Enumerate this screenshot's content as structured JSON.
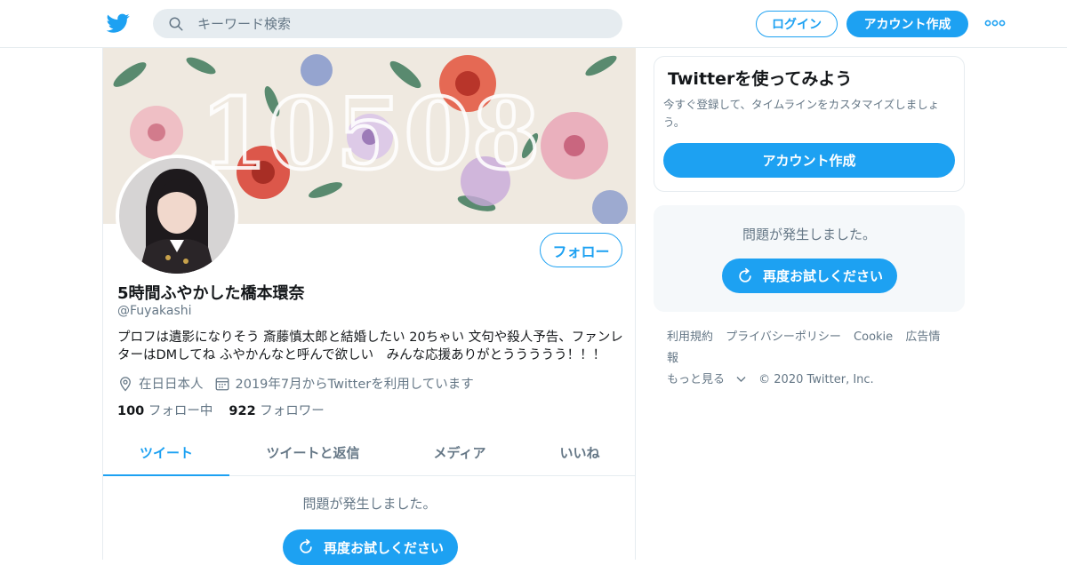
{
  "nav": {
    "search_placeholder": "キーワード検索",
    "login_label": "ログイン",
    "signup_label": "アカウント作成"
  },
  "profile": {
    "display_name": "5時間ふやかした橋本環奈",
    "handle": "@Fuyakashi",
    "bio": "プロフは遺影になりそう 斎藤慎太郎と結婚したい 20ちゃい 文句や殺人予告、ファンレターはDMしてね ふやかんなと呼んで欲しい　みんな応援ありがとううううう！！！",
    "location": "在日日本人",
    "joined": "2019年7月からTwitterを利用しています",
    "following_count": "100",
    "following_label": "フォロー中",
    "followers_count": "922",
    "followers_label": "フォロワー",
    "follow_label": "フォロー",
    "banner_text": "10508"
  },
  "tabs": [
    {
      "label": "ツイート",
      "active": true
    },
    {
      "label": "ツイートと返信",
      "active": false
    },
    {
      "label": "メディア",
      "active": false
    },
    {
      "label": "いいね",
      "active": false
    }
  ],
  "timeline": {
    "error_text": "問題が発生しました。",
    "retry_label": "再度お試しください"
  },
  "sidebar": {
    "card_title": "Twitterを使ってみよう",
    "card_text": "今すぐ登録して、タイムラインをカスタマイズしましょう。",
    "card_button": "アカウント作成",
    "error_text": "問題が発生しました。",
    "retry_label": "再度お試しください"
  },
  "footer": {
    "links": [
      "利用規約",
      "プライバシーポリシー",
      "Cookie",
      "広告情報"
    ],
    "more": "もっと見る",
    "copyright": "© 2020 Twitter, Inc."
  },
  "colors": {
    "accent": "#1da1f2",
    "muted": "#657786",
    "border": "#e6ecf0"
  },
  "icons": [
    "twitter-logo-icon",
    "search-icon",
    "more-icon",
    "location-icon",
    "calendar-icon",
    "refresh-icon",
    "chevron-down-icon"
  ]
}
